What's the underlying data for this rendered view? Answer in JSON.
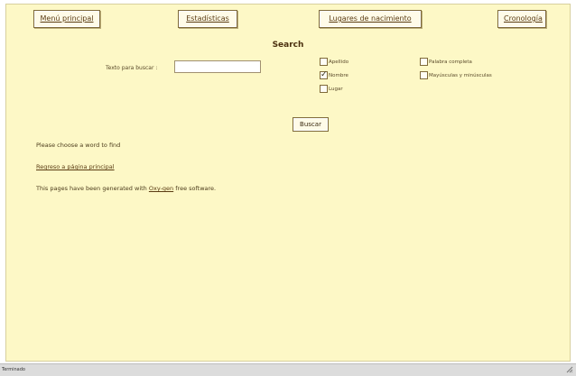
{
  "nav": {
    "menu_principal": "Menú principal",
    "estadisticas": "Estadísticas",
    "lugares_nacimiento": "Lugares de nacimiento",
    "cronologia": "Cronología"
  },
  "search": {
    "title": "Search",
    "label": "Texto para buscar :",
    "value": "",
    "placeholder": "",
    "options": {
      "apellido": {
        "label": "Apellido",
        "checked": false
      },
      "nombre": {
        "label": "Nombre",
        "checked": true
      },
      "lugar": {
        "label": "Lugar",
        "checked": false
      },
      "palabra_completa": {
        "label": "Palabra completa",
        "checked": false
      },
      "mayusculas": {
        "label": "Mayúsculas y minúsculas",
        "checked": false
      }
    },
    "button_label": "Buscar"
  },
  "messages": {
    "prompt": "Please choose a word to find",
    "back_link": "Regreso a página principal",
    "generated_prefix": "This pages have been generated with",
    "generated_link": "Oxy-gen",
    "generated_suffix": "free software."
  },
  "statusbar": {
    "text": "Terminado"
  },
  "colors": {
    "page_bg": "#fdf8c6",
    "text": "#3a2a10",
    "link": "#5a3b12"
  }
}
